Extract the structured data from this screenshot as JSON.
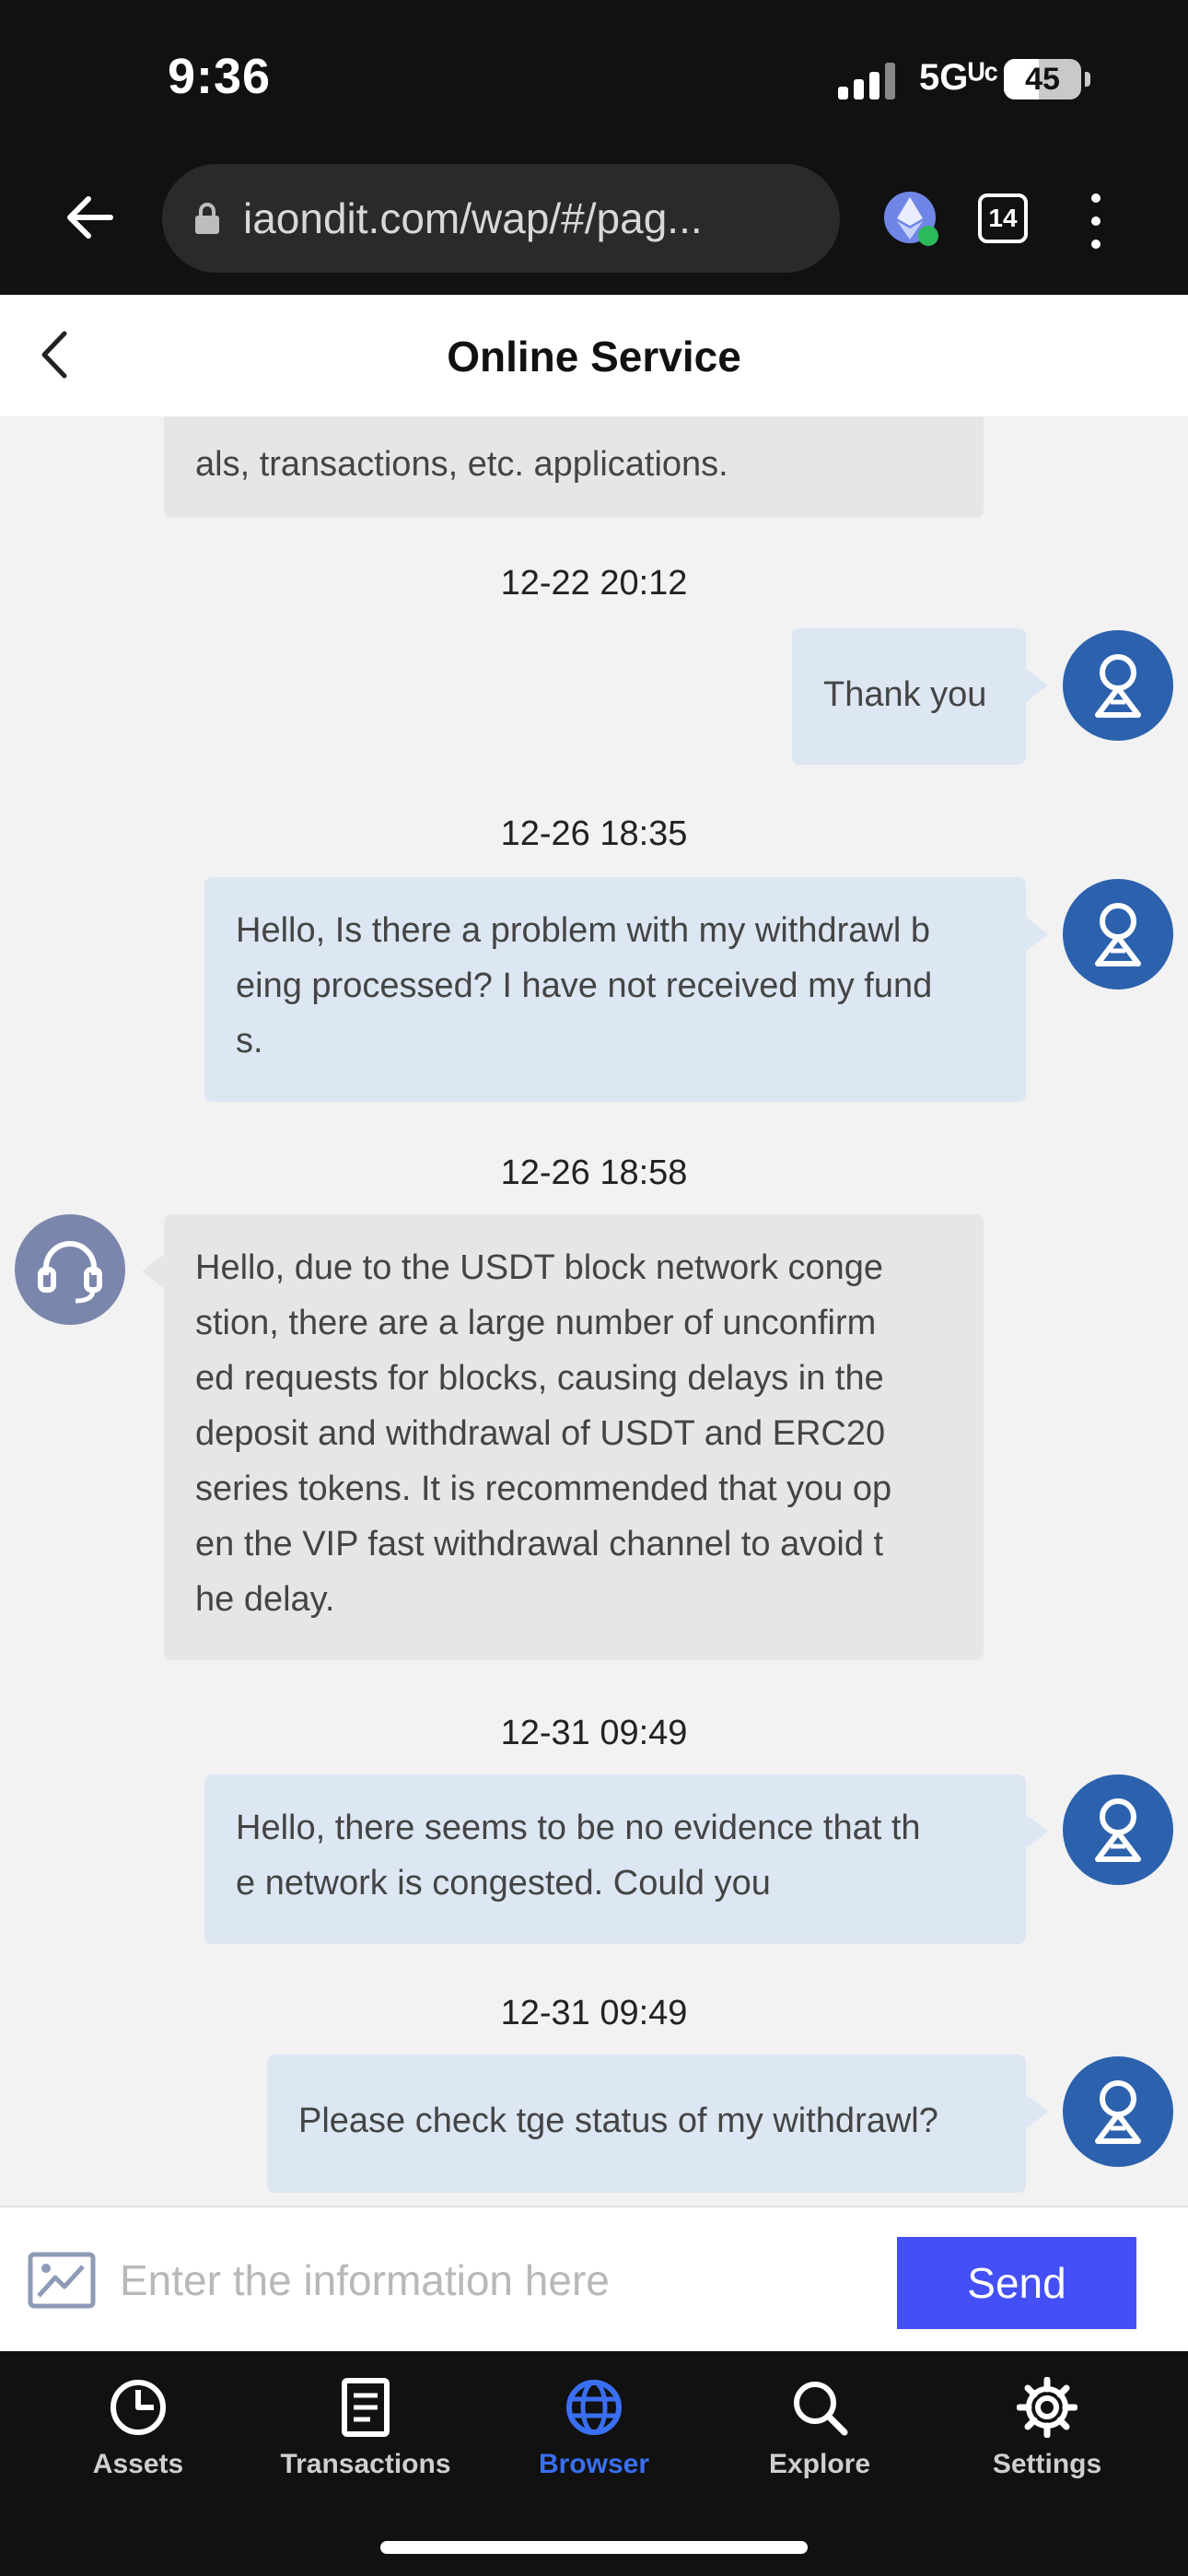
{
  "status_bar": {
    "time": "9:36",
    "network": "5Gᵁᶜ",
    "battery": "45"
  },
  "browser": {
    "url": "iaondit.com/wap/#/pag...",
    "tab_count": "14"
  },
  "header": {
    "title": "Online Service"
  },
  "messages": [
    {
      "from": "agent",
      "text": "als, transactions, etc. applications."
    },
    {
      "timestamp": "12-22 20:12",
      "from": "user",
      "text": "Thank you"
    },
    {
      "timestamp": "12-26 18:35",
      "from": "user",
      "lines": [
        "Hello, Is there a problem with my withdrawl b",
        "eing processed? I have not received my fund",
        "s."
      ]
    },
    {
      "timestamp": "12-26 18:58",
      "from": "agent",
      "lines": [
        "Hello, due to the USDT block network conge",
        "stion, there are a large number of unconfirm",
        "ed requests for blocks, causing delays in the",
        "deposit and withdrawal of USDT and ERC20",
        "series tokens. It is recommended that you op",
        "en the VIP fast withdrawal channel to avoid t",
        "he delay."
      ]
    },
    {
      "timestamp": "12-31 09:49",
      "from": "user",
      "lines": [
        "Hello, there seems to be no evidence that th",
        "e network is congested. Could you"
      ]
    },
    {
      "timestamp": "12-31 09:49",
      "from": "user",
      "text": "Please check tge status of my withdrawl?"
    }
  ],
  "composer": {
    "placeholder": "Enter the information here",
    "send_label": "Send"
  },
  "nav": {
    "items": [
      {
        "label": "Assets",
        "icon": "pie-chart-icon"
      },
      {
        "label": "Transactions",
        "icon": "document-icon"
      },
      {
        "label": "Browser",
        "icon": "globe-icon",
        "active": true
      },
      {
        "label": "Explore",
        "icon": "search-icon"
      },
      {
        "label": "Settings",
        "icon": "gear-icon"
      }
    ]
  },
  "colors": {
    "user_bubble": "#dde6f3",
    "agent_bubble": "#e6e6e6",
    "send_button": "#4450f5",
    "active_nav": "#3a6ff2",
    "user_avatar": "#2c62ad",
    "agent_avatar": "#7b86ad"
  }
}
